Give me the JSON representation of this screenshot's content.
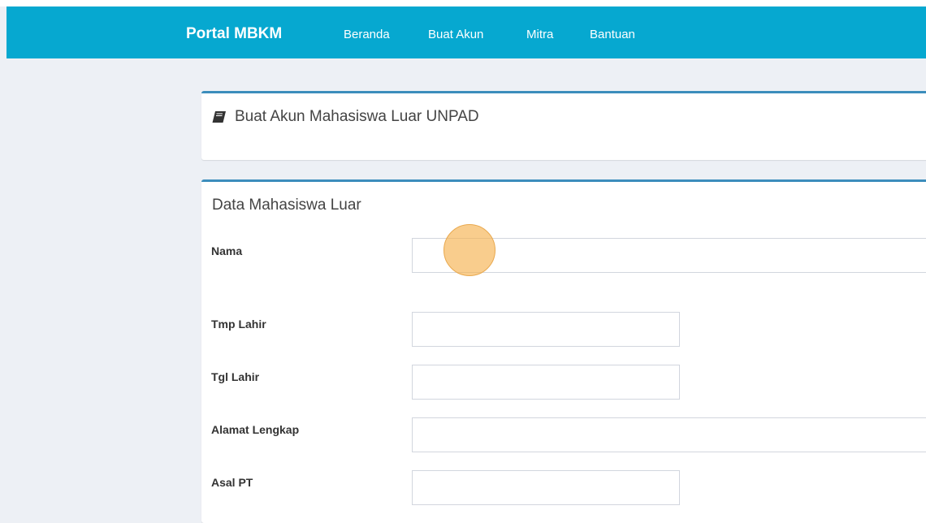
{
  "navbar": {
    "brand": "Portal MBKM",
    "items": [
      {
        "label": "Beranda"
      },
      {
        "label": "Buat Akun"
      },
      {
        "label": "Mitra"
      },
      {
        "label": "Bantuan"
      }
    ]
  },
  "header_box": {
    "icon": "book-icon",
    "title": "Buat Akun Mahasiswa Luar UNPAD"
  },
  "form": {
    "section_title": "Data Mahasiswa Luar",
    "fields": [
      {
        "label": "Nama",
        "value": ""
      },
      {
        "label": "Tmp Lahir",
        "value": ""
      },
      {
        "label": "Tgl Lahir",
        "value": ""
      },
      {
        "label": "Alamat Lengkap",
        "value": ""
      },
      {
        "label": "Asal PT",
        "value": ""
      }
    ]
  },
  "colors": {
    "navbar": "#06a8d0",
    "box_border": "#3c8dbc",
    "background": "#edf0f5"
  }
}
